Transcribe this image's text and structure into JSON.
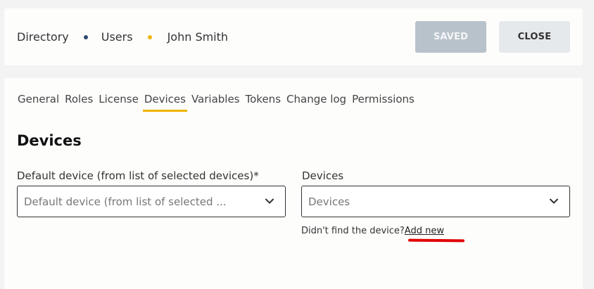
{
  "breadcrumb": {
    "items": [
      "Directory",
      "Users",
      "John Smith"
    ]
  },
  "header": {
    "saved_label": "SAVED",
    "close_label": "CLOSE"
  },
  "tabs": [
    "General",
    "Roles",
    "License",
    "Devices",
    "Variables",
    "Tokens",
    "Change log",
    "Permissions"
  ],
  "active_tab": "Devices",
  "section": {
    "title": "Devices"
  },
  "fields": {
    "default_device": {
      "label": "Default device (from list of selected devices)*",
      "placeholder": "Default device (from list of selected ..."
    },
    "devices": {
      "label": "Devices",
      "placeholder": "Devices"
    }
  },
  "hint": {
    "text": "Didn't find the device?",
    "link": "Add new"
  },
  "colors": {
    "accent": "#f0b400",
    "breadcrumb_dot_navy": "#2f4a6d",
    "annotation": "#e00000"
  },
  "icons": [
    "chevron-down-icon"
  ]
}
